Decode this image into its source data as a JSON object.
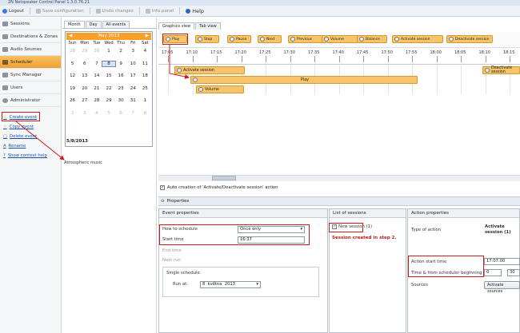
{
  "window": {
    "title": "2N Netspeaker Control Panel 1.3.0.76.21"
  },
  "toolbar": {
    "logout": "Logout",
    "save": "Save configuration",
    "undo": "Undo changes",
    "info": "Info panel",
    "help": "Help"
  },
  "sidebar": {
    "items": [
      {
        "label": "Sessions",
        "icon": "music-note-icon"
      },
      {
        "label": "Destinations & Zones",
        "icon": "speaker-icon"
      },
      {
        "label": "Audio Sources",
        "icon": "audio-icon"
      },
      {
        "label": "Scheduler",
        "icon": "calendar-icon"
      },
      {
        "label": "Sync Manager",
        "icon": "sync-icon"
      },
      {
        "label": "Users",
        "icon": "users-icon"
      },
      {
        "label": "Administrator",
        "icon": "gear-icon"
      }
    ],
    "tasks": [
      "Create event",
      "Copy event",
      "Delete event",
      "Rename",
      "Show context help"
    ]
  },
  "calendar": {
    "tabs": [
      "Month",
      "Day",
      "All events"
    ],
    "month_label": "May 2013",
    "days_of_week": [
      "Sun",
      "Mon",
      "Tue",
      "Wed",
      "Thu",
      "Fri",
      "Sat"
    ],
    "cells": [
      "28",
      "29",
      "30",
      "1",
      "2",
      "3",
      "4",
      "5",
      "6",
      "7",
      "8",
      "9",
      "10",
      "11",
      "12",
      "13",
      "14",
      "15",
      "16",
      "17",
      "18",
      "19",
      "20",
      "21",
      "22",
      "23",
      "24",
      "25",
      "26",
      "27",
      "28",
      "29",
      "30",
      "31",
      "1",
      "2",
      "3",
      "4",
      "5",
      "6",
      "7",
      "8"
    ],
    "muted_cells": [
      0,
      1,
      2,
      35,
      36,
      37,
      38,
      39,
      40,
      41
    ],
    "selected_cell": 10,
    "footer": "5/8/2013"
  },
  "music_label": "Atmospheric music",
  "graphics": {
    "tabs": [
      "Graphics view",
      "Tab view"
    ],
    "actions": [
      "Play",
      "Stop",
      "Pause",
      "Next",
      "Previous",
      "Volume",
      "Balance",
      "Activate session",
      "Deactivate session"
    ],
    "ticks": [
      "17:05",
      "17:10",
      "17:15",
      "17:20",
      "17:25",
      "17:30",
      "17:35",
      "17:40",
      "17:45",
      "17:50",
      "17:55",
      "18:00",
      "18:05",
      "18:10",
      "18:15"
    ],
    "bars": {
      "activate": "Activate session",
      "play": "Play",
      "volume": "Volume",
      "deactivate": "Deactivate session"
    },
    "auto_creation": "Auto creation of 'Activate/Deactivate session' action"
  },
  "properties": {
    "title": "Properties",
    "event": {
      "header": "Event properties",
      "how_label": "How to schedule",
      "how_value": "Once only",
      "start_label": "Start time",
      "start_value": "16:37",
      "end_label": "End time",
      "next_label": "Next run",
      "single_label": "Single schedule",
      "run_label": "Run at:",
      "run_day": "8",
      "run_month": "května",
      "run_year": "2013"
    },
    "sessions": {
      "header": "List of sessions",
      "item": "New session (1)",
      "note": "Session created in step 2."
    },
    "action": {
      "header": "Action properties",
      "type_label": "Type of action",
      "type_value": "Activate session (1)",
      "start_label": "Action start time",
      "start_value": "17:07:00",
      "offset_label": "Time & from scheduler beginning",
      "offset_value": "0",
      "offset_value2": "30",
      "sources_label": "Sources",
      "sources_button": "Activate sources"
    }
  },
  "colors": {
    "accent": "#f7a02c",
    "annotation": "#d01818",
    "bar": "#f6c56b",
    "link": "#1a4fa8"
  }
}
